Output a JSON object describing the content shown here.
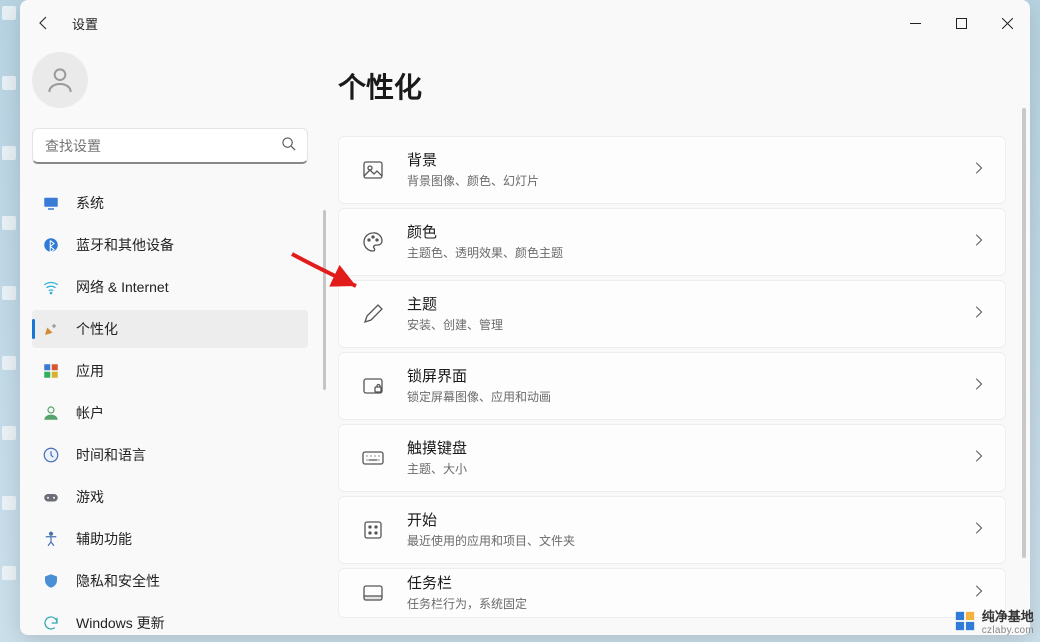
{
  "window": {
    "app_title": "设置"
  },
  "search": {
    "placeholder": "查找设置"
  },
  "sidebar": {
    "items": [
      {
        "label": "系统",
        "icon": "system"
      },
      {
        "label": "蓝牙和其他设备",
        "icon": "bluetooth"
      },
      {
        "label": "网络 & Internet",
        "icon": "wifi"
      },
      {
        "label": "个性化",
        "icon": "personalize",
        "active": true
      },
      {
        "label": "应用",
        "icon": "apps"
      },
      {
        "label": "帐户",
        "icon": "account"
      },
      {
        "label": "时间和语言",
        "icon": "time"
      },
      {
        "label": "游戏",
        "icon": "gaming"
      },
      {
        "label": "辅助功能",
        "icon": "accessibility"
      },
      {
        "label": "隐私和安全性",
        "icon": "privacy"
      },
      {
        "label": "Windows 更新",
        "icon": "update"
      }
    ]
  },
  "main": {
    "title": "个性化",
    "cards": [
      {
        "icon": "picture",
        "title": "背景",
        "sub": "背景图像、颜色、幻灯片"
      },
      {
        "icon": "palette",
        "title": "颜色",
        "sub": "主题色、透明效果、颜色主题"
      },
      {
        "icon": "pen",
        "title": "主题",
        "sub": "安装、创建、管理"
      },
      {
        "icon": "lock",
        "title": "锁屏界面",
        "sub": "锁定屏幕图像、应用和动画"
      },
      {
        "icon": "keyboard",
        "title": "触摸键盘",
        "sub": "主题、大小"
      },
      {
        "icon": "start",
        "title": "开始",
        "sub": "最近使用的应用和项目、文件夹"
      },
      {
        "icon": "taskbar",
        "title": "任务栏",
        "sub": "任务栏行为，系统固定"
      }
    ]
  },
  "watermark": {
    "brand": "纯净基地",
    "url": "czlaby.com"
  }
}
